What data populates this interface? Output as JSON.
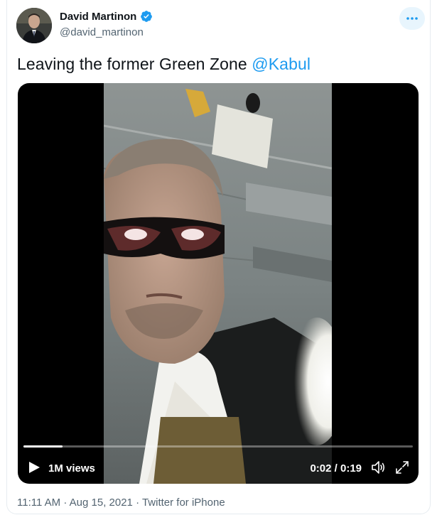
{
  "author": {
    "name": "David Martinon",
    "handle": "@david_martinon"
  },
  "tweet": {
    "text": "Leaving the former Green Zone ",
    "mention": "@Kabul"
  },
  "video": {
    "views": "1M views",
    "time": "0:02 / 0:19",
    "progress": 0.1
  },
  "footer": {
    "meta": "11:11 AM · Aug 15, 2021 · Twitter for iPhone"
  },
  "icons": {
    "more": "more-icon",
    "verified": "verified-badge-icon",
    "play": "play-icon",
    "volume": "volume-icon",
    "fullscreen": "fullscreen-icon"
  },
  "colors": {
    "accent": "#1d9bf0",
    "text": "#0f1419",
    "muted": "#536471"
  }
}
